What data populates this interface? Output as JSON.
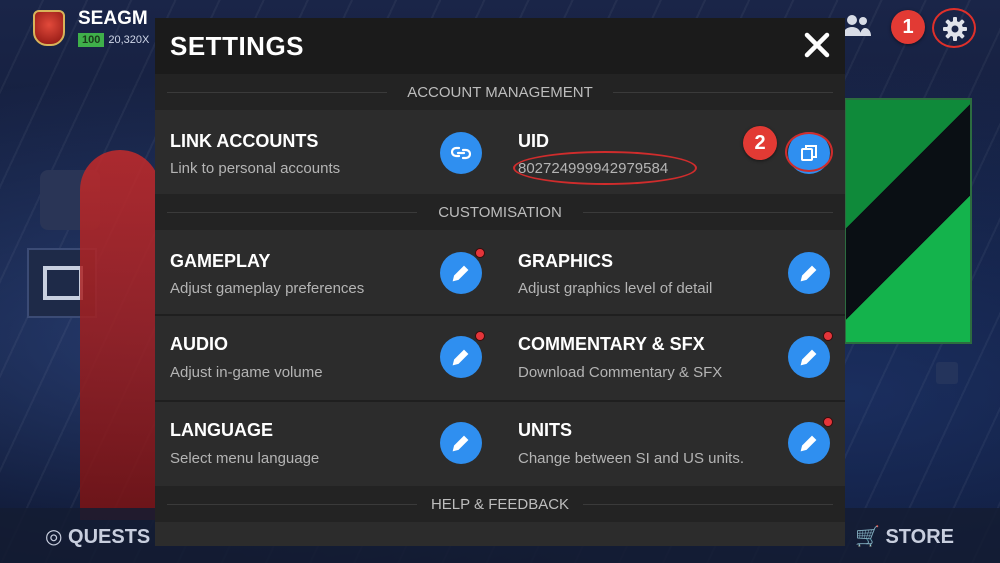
{
  "background": {
    "club_name": "SEAGM",
    "club_level": "100",
    "club_sub": "20,320X",
    "quests_label": "QUESTS",
    "store_label": "STORE"
  },
  "markers": {
    "one": "1",
    "two": "2"
  },
  "modal": {
    "title": "SETTINGS",
    "sections": {
      "account": "ACCOUNT MANAGEMENT",
      "customisation": "CUSTOMISATION",
      "help": "HELP & FEEDBACK"
    },
    "link_accounts": {
      "title": "LINK ACCOUNTS",
      "subtitle": "Link to personal accounts"
    },
    "uid": {
      "title": "UID",
      "value": "802724999942979584"
    },
    "gameplay": {
      "title": "GAMEPLAY",
      "subtitle": "Adjust gameplay preferences"
    },
    "graphics": {
      "title": "GRAPHICS",
      "subtitle": "Adjust graphics level of detail"
    },
    "audio": {
      "title": "AUDIO",
      "subtitle": "Adjust in-game volume"
    },
    "commentary": {
      "title": "COMMENTARY & SFX",
      "subtitle": "Download Commentary & SFX"
    },
    "language": {
      "title": "LANGUAGE",
      "subtitle": "Select menu language"
    },
    "units": {
      "title": "UNITS",
      "subtitle": "Change between SI and US units."
    }
  },
  "colors": {
    "accent_blue": "#2f8ff0",
    "marker_red": "#e23a34",
    "notification_dot": "#e5353a"
  },
  "icons": [
    "gear-icon",
    "friends-icon",
    "close-icon",
    "link-icon",
    "copy-icon",
    "edit-pencil-icon",
    "quests-icon",
    "store-cart-icon",
    "lock-icon",
    "news-icon"
  ]
}
